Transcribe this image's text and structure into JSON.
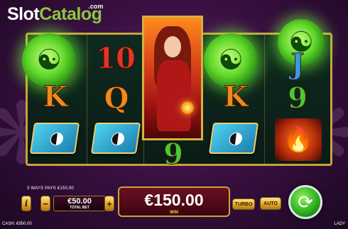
{
  "branding": {
    "logo_part1": "Slot",
    "logo_part2": "Catalog",
    "logo_suffix": ".com"
  },
  "reels": {
    "columns": [
      {
        "symbols": [
          "yin-yang-dragon-orb",
          "K",
          "book"
        ]
      },
      {
        "symbols": [
          "10",
          "Q",
          "book"
        ]
      },
      {
        "symbols": [
          "lady",
          "lady",
          "9"
        ]
      },
      {
        "symbols": [
          "yin-yang-dragon-orb",
          "K",
          "book"
        ]
      },
      {
        "symbols": [
          "J",
          "9",
          "phoenix"
        ]
      }
    ],
    "letters": {
      "r1_k": "K",
      "r2_10": "10",
      "r2_q": "Q",
      "r3_9": "9",
      "r4_k": "K",
      "r5_j": "J",
      "r5_9": "9"
    },
    "colors": {
      "letter_orange": "#f08a1c",
      "letter_red": "#e8322a",
      "letter_green": "#4ac83a",
      "letter_blue": "#3a9ae8",
      "frame_gold": "#c9a23b"
    }
  },
  "status": {
    "ways_pays": "3 WAYS PAYS €150.00"
  },
  "controls": {
    "info_label": "i",
    "minus_label": "−",
    "plus_label": "+",
    "bet_value": "€50.00",
    "bet_label": "TOTAL BET",
    "win_value": "€150.00",
    "win_label": "WIN",
    "turbo_label": "TURBO",
    "auto_label": "AUTO",
    "spin_icon": "spin-arrows-icon"
  },
  "footer": {
    "cash": "CASH: €950.00",
    "game_name": "LADY"
  }
}
